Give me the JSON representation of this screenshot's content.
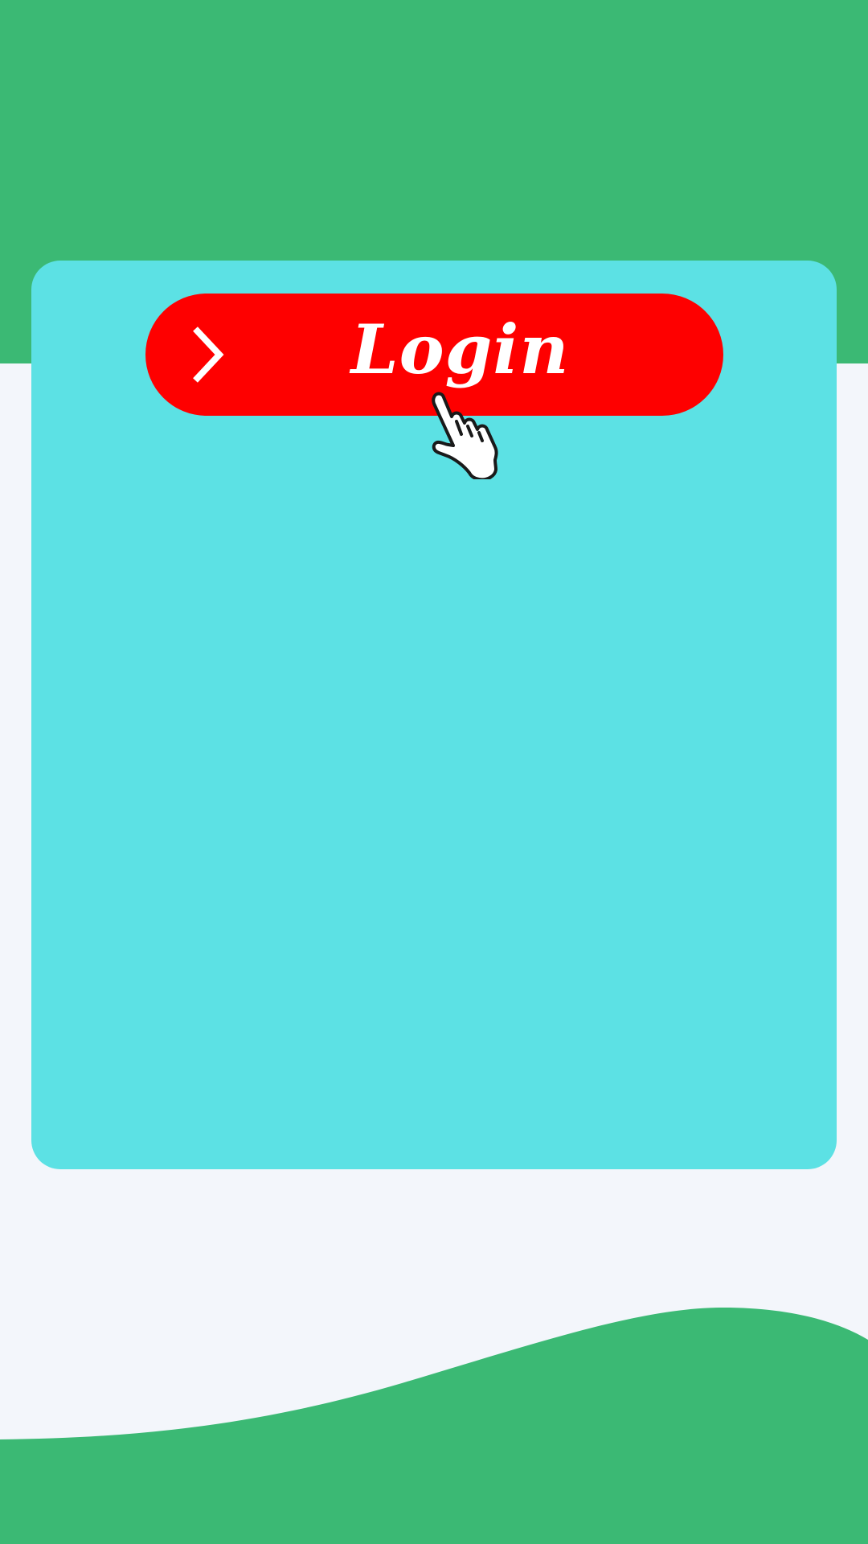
{
  "login_button": {
    "label": "Login",
    "icon": "chevron-right-icon"
  },
  "cursor": {
    "icon": "hand-pointer-icon"
  },
  "colors": {
    "brand_green": "#3bb974",
    "card_cyan": "#5ce1e4",
    "button_red": "#fe0000",
    "page_background": "#f3f6fb",
    "text_white": "#ffffff"
  }
}
